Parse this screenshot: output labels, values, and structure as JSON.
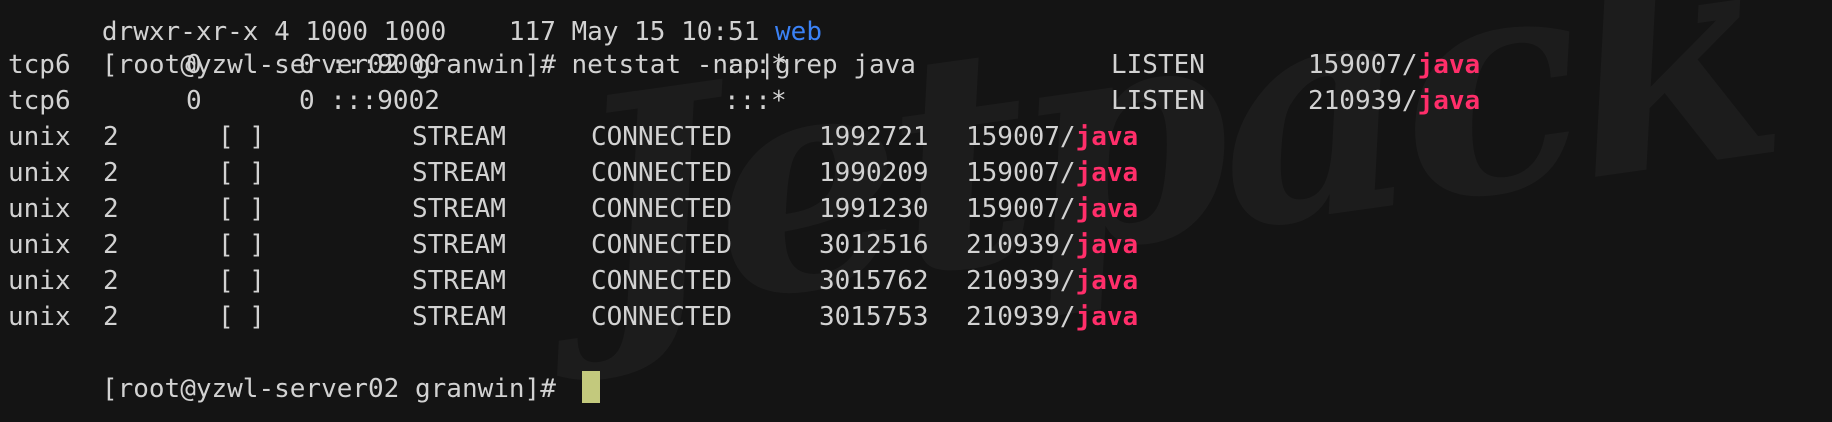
{
  "terminal": {
    "top_cut_line": "drwxr-xr-x 4 1000 1000    117 May 15 10:51 web",
    "top_cut_line_dir": "web",
    "watermark": "Jetpack"
  },
  "command": {
    "prompt": "[root@yzwl-server02 granwin]# ",
    "text": "netstat -nap|grep java"
  },
  "rows": [
    {
      "proto": "tcp6",
      "recv": "0",
      "send": "0 :::9000",
      "foreign": ":::*",
      "state": "LISTEN",
      "pid": "159007/",
      "prog": "java"
    },
    {
      "proto": "tcp6",
      "recv": "0",
      "send": "0 :::9002",
      "foreign": ":::*",
      "state": "LISTEN",
      "pid": "210939/",
      "prog": "java"
    },
    {
      "proto": "unix",
      "refcnt": "2",
      "flags": "[ ]",
      "type": "STREAM",
      "state": "CONNECTED",
      "inode": "1992721",
      "pid": "159007/",
      "prog": "java"
    },
    {
      "proto": "unix",
      "refcnt": "2",
      "flags": "[ ]",
      "type": "STREAM",
      "state": "CONNECTED",
      "inode": "1990209",
      "pid": "159007/",
      "prog": "java"
    },
    {
      "proto": "unix",
      "refcnt": "2",
      "flags": "[ ]",
      "type": "STREAM",
      "state": "CONNECTED",
      "inode": "1991230",
      "pid": "159007/",
      "prog": "java"
    },
    {
      "proto": "unix",
      "refcnt": "2",
      "flags": "[ ]",
      "type": "STREAM",
      "state": "CONNECTED",
      "inode": "3012516",
      "pid": "210939/",
      "prog": "java"
    },
    {
      "proto": "unix",
      "refcnt": "2",
      "flags": "[ ]",
      "type": "STREAM",
      "state": "CONNECTED",
      "inode": "3015762",
      "pid": "210939/",
      "prog": "java"
    },
    {
      "proto": "unix",
      "refcnt": "2",
      "flags": "[ ]",
      "type": "STREAM",
      "state": "CONNECTED",
      "inode": "3015753",
      "pid": "210939/",
      "prog": "java"
    }
  ],
  "final_prompt": {
    "prompt": "[root@yzwl-server02 granwin]# "
  },
  "colors": {
    "background": "#141414",
    "text": "#d2d2d2",
    "program_highlight": "#ff2e6a",
    "cursor": "#c3c97d",
    "dir_blue": "#3b82f6"
  }
}
